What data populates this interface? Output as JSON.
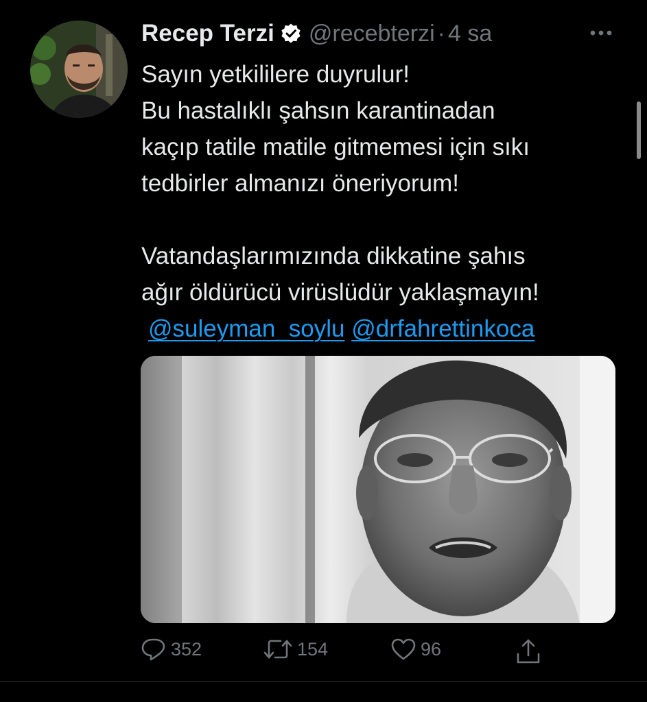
{
  "tweet": {
    "author": {
      "display_name": "Recep Terzi",
      "verified": true,
      "handle": "@recebterzi",
      "separator": "·",
      "timestamp": "4 sa"
    },
    "text_lines": [
      "Sayın yetkililere duyrulur!",
      "Bu hastalıklı şahsın karantinadan",
      "kaçıp tatile matile gitmemesi için sıkı",
      "tedbirler almanızı öneriyorum!",
      "Vatandaşlarımızında dikkatine şahıs",
      "ağır öldürücü virüslüdür yaklaşmayın!"
    ],
    "mentions": [
      "@suleyman_soylu",
      "@drfahrettinkoca"
    ],
    "stats": {
      "replies": "352",
      "retweets": "154",
      "likes": "96"
    }
  },
  "icons": {
    "avatar": "avatar",
    "verified": "verified-badge-icon",
    "more": "more-options-icon",
    "reply": "reply-icon",
    "retweet": "retweet-icon",
    "like": "heart-icon",
    "share": "share-icon"
  },
  "colors": {
    "background": "#000000",
    "text": "#e7e9ea",
    "secondary_text": "#71767b",
    "link": "#1d9bf0"
  }
}
